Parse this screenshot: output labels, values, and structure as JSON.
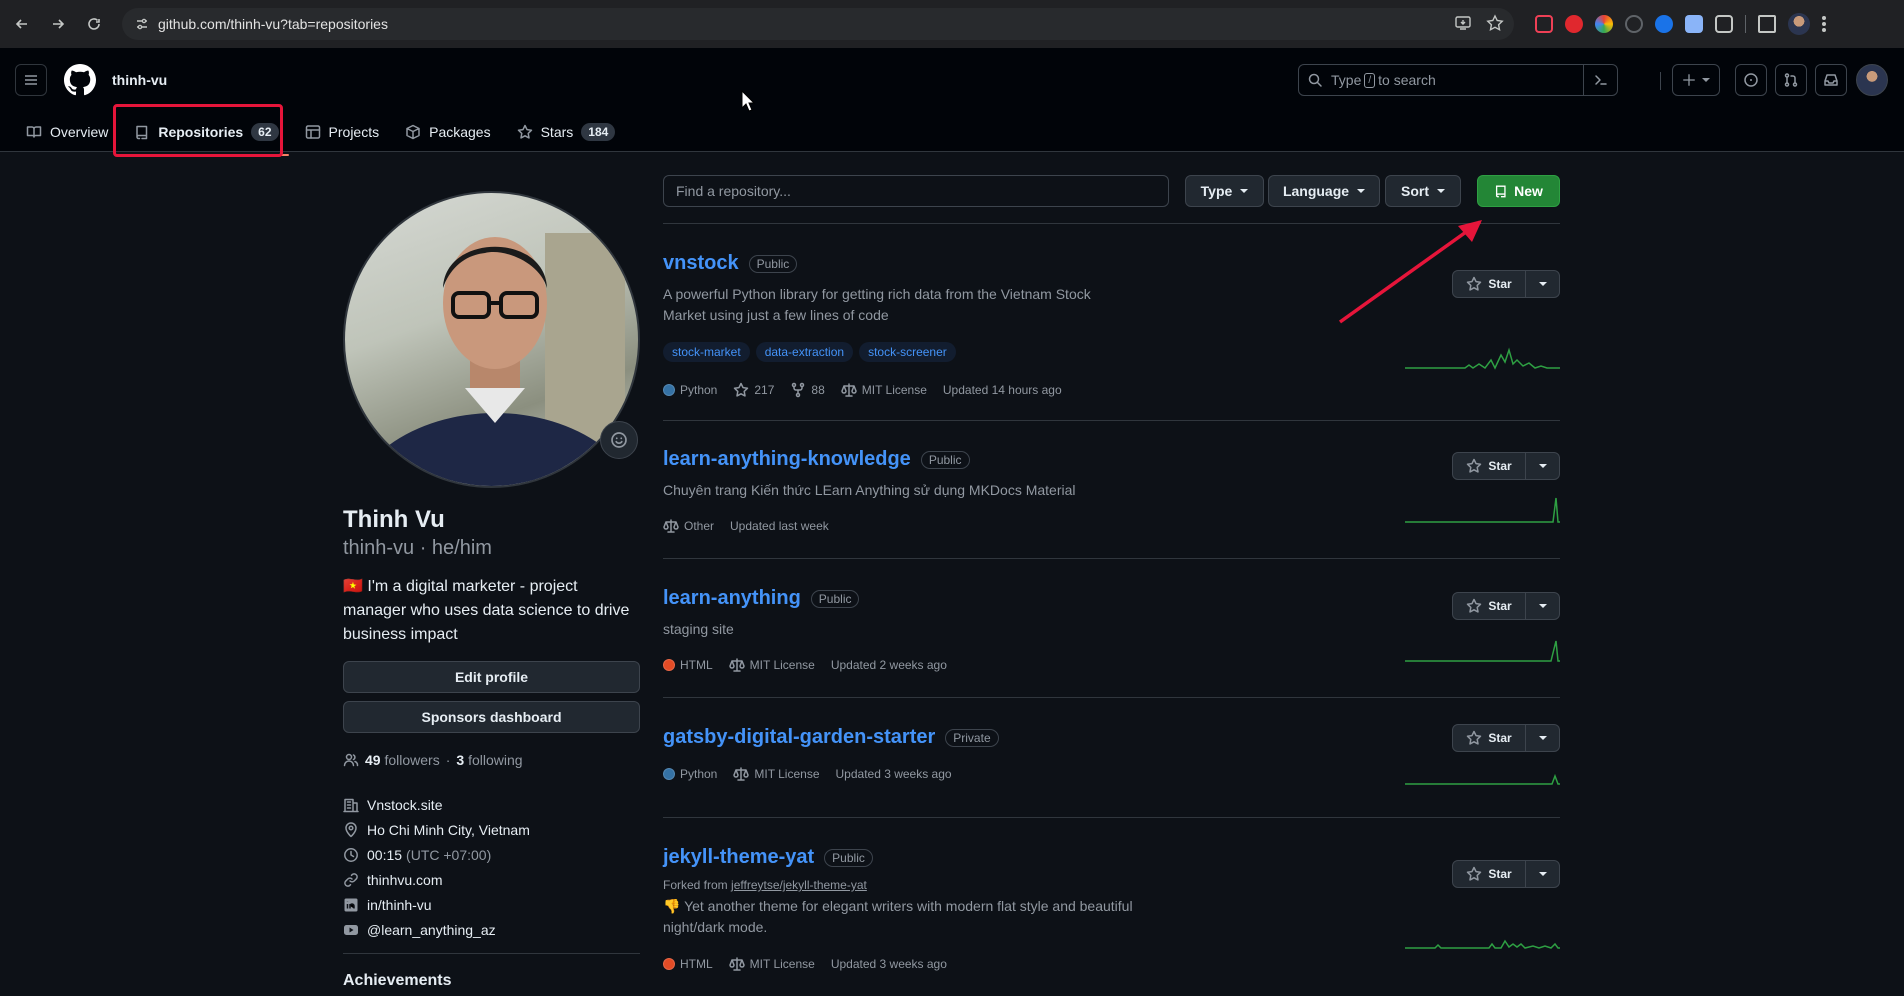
{
  "browser": {
    "url": "github.com/thinh-vu?tab=repositories"
  },
  "header": {
    "username": "thinh-vu",
    "search_prefix": "Type",
    "search_key": "/",
    "search_suffix": "to search"
  },
  "tabs": [
    {
      "label": "Overview"
    },
    {
      "label": "Repositories",
      "count": "62"
    },
    {
      "label": "Projects"
    },
    {
      "label": "Packages"
    },
    {
      "label": "Stars",
      "count": "184"
    }
  ],
  "profile": {
    "name": "Thinh Vu",
    "login": "thinh-vu · he/him",
    "bio": "🇻🇳 I'm a digital marketer - project manager who uses data science to drive business impact",
    "edit_profile": "Edit profile",
    "sponsors_dashboard": "Sponsors dashboard",
    "followers_count": "49",
    "followers_label": "followers",
    "following_count": "3",
    "following_label": "following",
    "company": "Vnstock.site",
    "location": "Ho Chi Minh City, Vietnam",
    "local_time": "00:15",
    "timezone": "(UTC +07:00)",
    "website": "thinhvu.com",
    "linkedin": "in/thinh-vu",
    "youtube": "@learn_anything_az",
    "achievements": "Achievements"
  },
  "repo_toolbar": {
    "search_placeholder": "Find a repository...",
    "type": "Type",
    "language": "Language",
    "sort": "Sort",
    "new": "New"
  },
  "star_label": "Star",
  "repos": [
    {
      "name": "vnstock",
      "visibility": "Public",
      "description": "A powerful Python library for getting rich data from the Vietnam Stock Market using just a few lines of code",
      "topics": [
        "stock-market",
        "data-extraction",
        "stock-screener"
      ],
      "language": "Python",
      "language_color": "#3572A5",
      "stars": "217",
      "forks": "88",
      "license": "MIT License",
      "updated": "Updated 14 hours ago"
    },
    {
      "name": "learn-anything-knowledge",
      "visibility": "Public",
      "description": "Chuyên trang Kiến thức LEarn Anything sử dụng MKDocs Material",
      "license": "Other",
      "updated": "Updated last week"
    },
    {
      "name": "learn-anything",
      "visibility": "Public",
      "description": "staging site",
      "language": "HTML",
      "language_color": "#e34c26",
      "license": "MIT License",
      "updated": "Updated 2 weeks ago"
    },
    {
      "name": "gatsby-digital-garden-starter",
      "visibility": "Private",
      "language": "Python",
      "language_color": "#3572A5",
      "license": "MIT License",
      "updated": "Updated 3 weeks ago"
    },
    {
      "name": "jekyll-theme-yat",
      "visibility": "Public",
      "forked_prefix": "Forked from",
      "forked_from": "jeffreytse/jekyll-theme-yat",
      "description": "👎 Yet another theme for elegant writers with modern flat style and beautiful night/dark mode.",
      "language": "HTML",
      "language_color": "#e34c26",
      "license": "MIT License",
      "updated": "Updated 3 weeks ago"
    }
  ],
  "colors": {
    "accent_link": "#4493f8",
    "new_button": "#238636",
    "highlight": "#e6153a",
    "sparkline": "#2ea043"
  }
}
